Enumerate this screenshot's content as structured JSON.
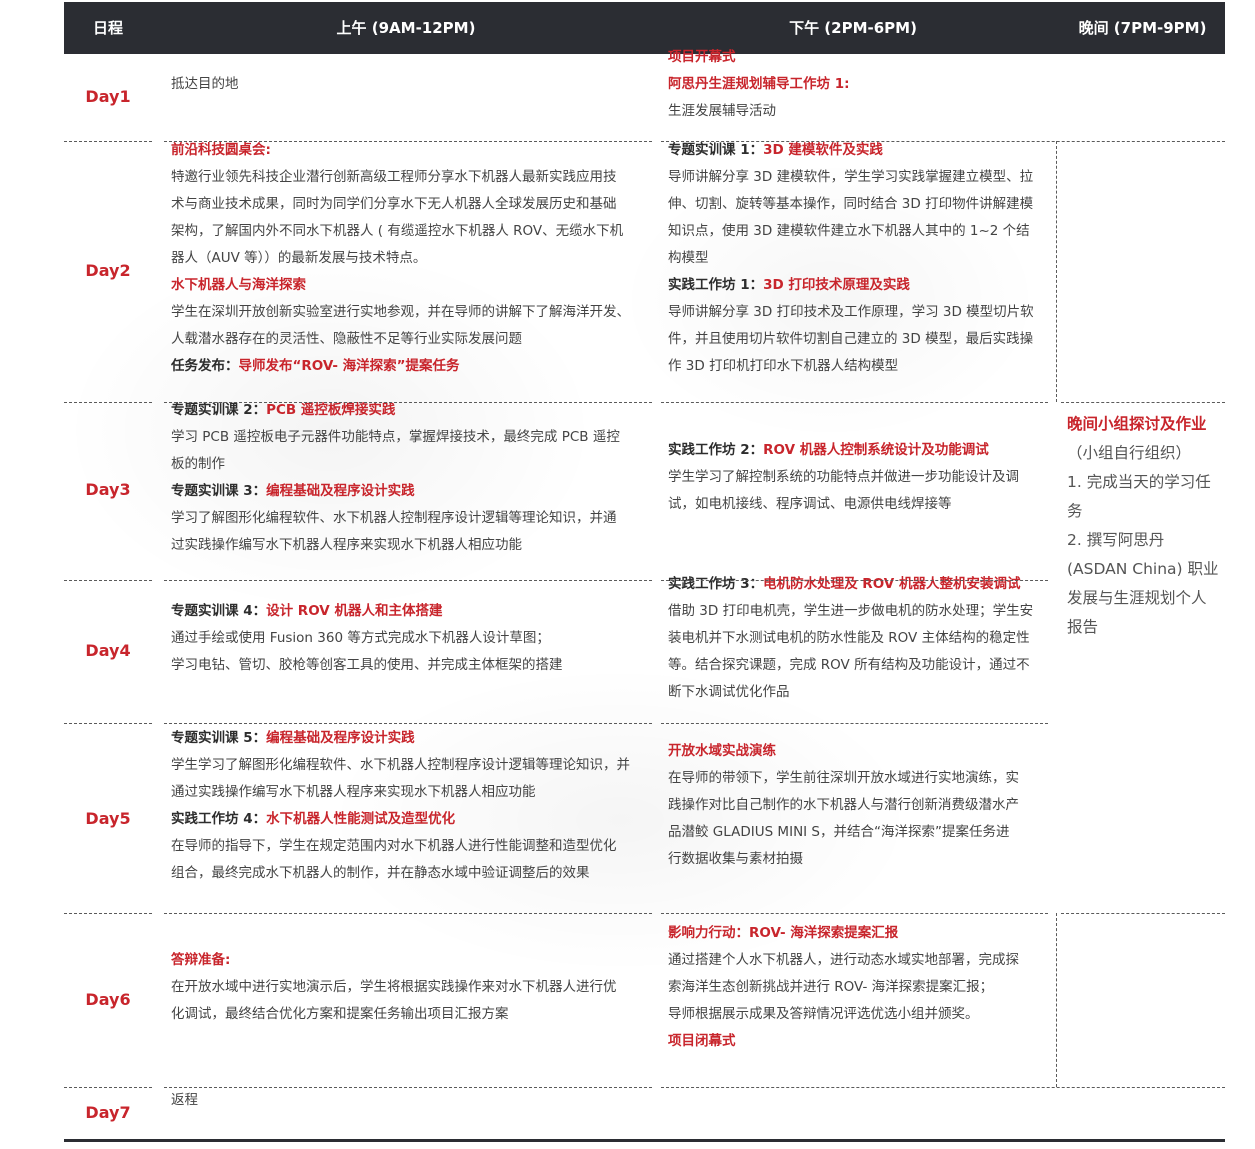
{
  "header": {
    "col_day": "日程",
    "col_morning": "上午 (9AM-12PM)",
    "col_afternoon": "下午 (2PM-6PM)",
    "col_evening": "晚间 (7PM-9PM)"
  },
  "days": [
    {
      "label": "Day1",
      "am": [
        {
          "text": "抵达目的地"
        }
      ],
      "pm": [
        {
          "text": "项目开幕式",
          "style": "red"
        },
        {
          "text": "阿思丹生涯规划辅导工作坊 1:",
          "style": "red"
        },
        {
          "text": "生涯发展辅导活动"
        }
      ]
    },
    {
      "label": "Day2",
      "am": [
        {
          "text": "前沿科技圆桌会:",
          "style": "red"
        },
        {
          "text": "特邀行业领先科技企业潜行创新高级工程师分享水下机器人最新实践应用技"
        },
        {
          "text": "术与商业技术成果，同时为同学们分享水下无人机器人全球发展历史和基础"
        },
        {
          "text": "架构，了解国内外不同水下机器人 ( 有缆遥控水下机器人 ROV、无缆水下机"
        },
        {
          "text": "器人（AUV 等））的最新发展与技术特点。"
        },
        {
          "text": "水下机器人与海洋探索",
          "style": "red"
        },
        {
          "text": "学生在深圳开放创新实验室进行实地参观，并在导师的讲解下了解海洋开发、"
        },
        {
          "text": "人载潜水器存在的灵活性、隐蔽性不足等行业实际发展问题"
        },
        {
          "prefix": "任务发布：",
          "text": "导师发布“ROV- 海洋探索”提案任务",
          "style": "mixed"
        }
      ],
      "pm": [
        {
          "prefix": "专题实训课 1：",
          "text": "3D 建模软件及实践",
          "style": "mixed"
        },
        {
          "text": "导师讲解分享 3D 建模软件，学生学习实践掌握建立模型、拉"
        },
        {
          "text": "伸、切割、旋转等基本操作，同时结合 3D 打印物件讲解建模"
        },
        {
          "text": "知识点，使用 3D 建模软件建立水下机器人其中的 1~2 个结"
        },
        {
          "text": "构模型"
        },
        {
          "prefix": "实践工作坊 1：",
          "text": "3D 打印技术原理及实践",
          "style": "mixed"
        },
        {
          "text": "导师讲解分享 3D 打印技术及工作原理，学习 3D 模型切片软"
        },
        {
          "text": "件，并且使用切片软件切割自己建立的 3D 模型，最后实践操"
        },
        {
          "text": "作 3D 打印机打印水下机器人结构模型"
        }
      ]
    },
    {
      "label": "Day3",
      "am": [
        {
          "prefix": "专题实训课 2：",
          "text": "PCB 遥控板焊接实践",
          "style": "mixed"
        },
        {
          "text": "学习 PCB 遥控板电子元器件功能特点，掌握焊接技术，最终完成 PCB 遥控"
        },
        {
          "text": "板的制作"
        },
        {
          "prefix": "专题实训课 3：",
          "text": "编程基础及程序设计实践",
          "style": "mixed"
        },
        {
          "text": "学习了解图形化编程软件、水下机器人控制程序设计逻辑等理论知识，并通"
        },
        {
          "text": "过实践操作编写水下机器人程序来实现水下机器人相应功能"
        }
      ],
      "pm": [
        {
          "prefix": "实践工作坊 2：",
          "text": "ROV 机器人控制系统设计及功能调试",
          "style": "mixed"
        },
        {
          "text": "学生学习了解控制系统的功能特点并做进一步功能设计及调"
        },
        {
          "text": "试，如电机接线、程序调试、电源供电线焊接等"
        }
      ]
    },
    {
      "label": "Day4",
      "am": [
        {
          "prefix": "专题实训课 4：",
          "text": "设计 ROV 机器人和主体搭建",
          "style": "mixed"
        },
        {
          "text": "通过手绘或使用 Fusion 360 等方式完成水下机器人设计草图；"
        },
        {
          "text": "学习电钻、管切、胶枪等创客工具的使用、并完成主体框架的搭建"
        }
      ],
      "pm": [
        {
          "prefix": "实践工作坊 3：",
          "text": "电机防水处理及 ROV 机器人整机安装调试",
          "style": "mixed"
        },
        {
          "text": "借助 3D 打印电机壳，学生进一步做电机的防水处理；学生安"
        },
        {
          "text": "装电机并下水测试电机的防水性能及 ROV 主体结构的稳定性"
        },
        {
          "text": "等。结合探究课题，完成 ROV 所有结构及功能设计，通过不"
        },
        {
          "text": "断下水调试优化作品"
        }
      ]
    },
    {
      "label": "Day5",
      "am": [
        {
          "prefix": "专题实训课 5：",
          "text": "编程基础及程序设计实践",
          "style": "mixed"
        },
        {
          "text": "学生学习了解图形化编程软件、水下机器人控制程序设计逻辑等理论知识，并"
        },
        {
          "text": "通过实践操作编写水下机器人程序来实现水下机器人相应功能"
        },
        {
          "prefix": "实践工作坊 4：",
          "text": "水下机器人性能测试及造型优化",
          "style": "mixed"
        },
        {
          "text": "在导师的指导下，学生在规定范围内对水下机器人进行性能调整和造型优化"
        },
        {
          "text": "组合，最终完成水下机器人的制作，并在静态水域中验证调整后的效果"
        }
      ],
      "pm": [
        {
          "text": "开放水域实战演练",
          "style": "red"
        },
        {
          "text": "在导师的带领下，学生前往深圳开放水域进行实地演练，实"
        },
        {
          "text": "践操作对比自己制作的水下机器人与潜行创新消费级潜水产"
        },
        {
          "text": "品潜鲛 GLADIUS MINI S，并结合“海洋探索”提案任务进"
        },
        {
          "text": "行数据收集与素材拍摄"
        }
      ]
    },
    {
      "label": "Day6",
      "am": [
        {
          "text": "答辩准备:",
          "style": "red"
        },
        {
          "text": "在开放水域中进行实地演示后，学生将根据实践操作来对水下机器人进行优"
        },
        {
          "text": "化调试，最终结合优化方案和提案任务输出项目汇报方案"
        }
      ],
      "pm": [
        {
          "text": "影响力行动：ROV- 海洋探索提案汇报",
          "style": "red"
        },
        {
          "text": "通过搭建个人水下机器人，进行动态水域实地部署，完成探"
        },
        {
          "text": "索海洋生态创新挑战并进行 ROV- 海洋探索提案汇报；"
        },
        {
          "text": "导师根据展示成果及答辩情况评选优选小组并颁奖。"
        },
        {
          "text": "项目闭幕式",
          "style": "red"
        }
      ]
    },
    {
      "label": "Day7",
      "am": [
        {
          "text": "返程"
        }
      ],
      "pm": []
    }
  ],
  "evening": {
    "title": "晚间小组探讨及作业",
    "lines": [
      "（小组自行组织）",
      "1. 完成当天的学习任",
      "务",
      "2. 撰写阿思丹",
      "(ASDAN China) 职业",
      "发展与生涯规划个人",
      "报告"
    ]
  },
  "colors": {
    "header_bg": "#2b2d33",
    "accent_red": "#c8252c",
    "text": "#444444"
  }
}
